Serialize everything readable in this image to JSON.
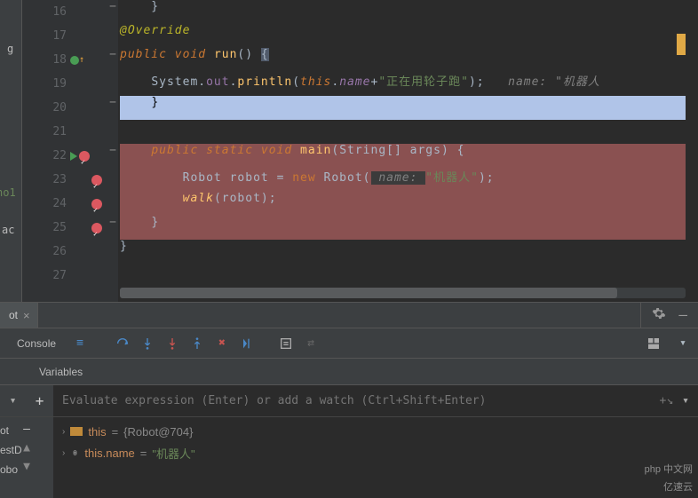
{
  "editor": {
    "lines": {
      "16": {
        "no": "16",
        "fold": "−"
      },
      "17": {
        "no": "17",
        "ann": "@Override"
      },
      "18": {
        "no": "18",
        "fold": "−",
        "kw1": "public",
        "kw2": "void",
        "mtd": "run",
        "p": "()",
        "br": "{"
      },
      "19": {
        "no": "19",
        "cls": "System",
        "d1": ".",
        "out": "out",
        "d2": ".",
        "pl": "println",
        "lp": "(",
        "th": "this",
        "d3": ".",
        "nm": "name",
        "plus": "+",
        "str": "\"正在用轮子跑\"",
        "rp": ");",
        "cmt": "name: \"机器人"
      },
      "20": {
        "no": "20",
        "fold": "−",
        "br": "}"
      },
      "21": {
        "no": "21"
      },
      "22": {
        "no": "22",
        "fold": "−",
        "kw1": "public",
        "kw2": "static",
        "kw3": "void",
        "mtd": "main",
        "lp": "(",
        "cls": "String",
        "arr": "[]",
        "par": "args",
        "rp": ")",
        "br": "{"
      },
      "23": {
        "no": "23",
        "cls": "Robot",
        "var": "robot",
        "eq": "=",
        "nw": "new",
        "ctor": "Robot",
        "lp": "(",
        "hint": " name: ",
        "str": "\"机器人\"",
        "rp": ");"
      },
      "24": {
        "no": "24",
        "mtd": "walk",
        "lp": "(",
        "arg": "robot",
        "rp": ");"
      },
      "25": {
        "no": "25",
        "fold": "−",
        "br": "}"
      },
      "26": {
        "no": "26",
        "br": "}"
      },
      "27": {
        "no": "27"
      }
    }
  },
  "tab": {
    "name": "ot",
    "close": "×"
  },
  "toolbar": {
    "console": "Console",
    "gear": "settings",
    "minimize": "minimize"
  },
  "vars": {
    "header": "Variables",
    "placeholder": "Evaluate expression (Enter) or add a watch (Ctrl+Shift+Enter)",
    "row1": {
      "name": "this",
      "eq": " = ",
      "val": "{Robot@704}"
    },
    "row2": {
      "name": "this.name",
      "eq": " = ",
      "val": "\"机器人\""
    }
  },
  "leftEdge": {
    "t1": "g",
    "t2": "no1",
    "t3": "ac"
  },
  "sideList": {
    "i1": "ot",
    "i2": "estD",
    "i3": "obo"
  },
  "watermark": {
    "l1": "php 中文网",
    "l2": "亿速云"
  }
}
